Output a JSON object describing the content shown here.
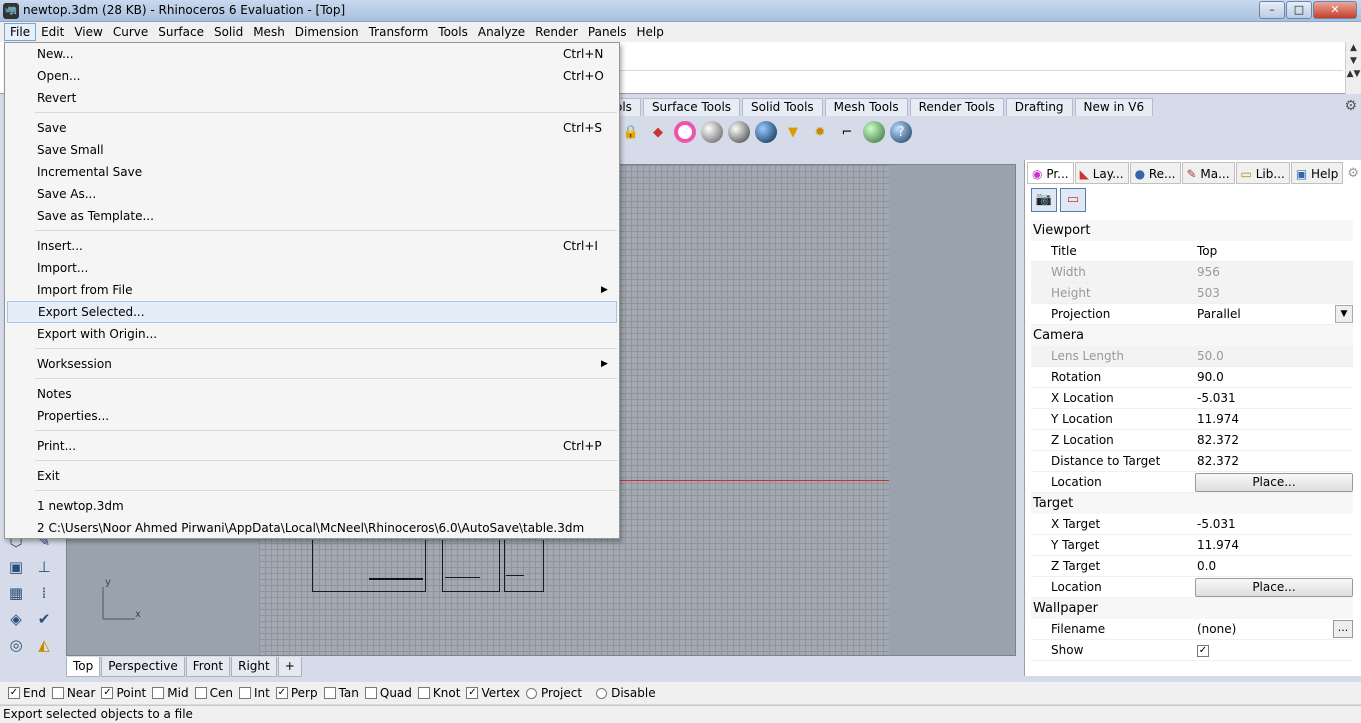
{
  "window": {
    "title": "newtop.3dm (28 KB) - Rhinoceros 6 Evaluation - [Top]",
    "minimize": "–",
    "maximize": "□",
    "close": "✕"
  },
  "menubar": [
    "File",
    "Edit",
    "View",
    "Curve",
    "Surface",
    "Solid",
    "Mesh",
    "Dimension",
    "Transform",
    "Tools",
    "Analyze",
    "Render",
    "Panels",
    "Help"
  ],
  "file_menu": {
    "groups": [
      [
        {
          "label": "New...",
          "shortcut": "Ctrl+N"
        },
        {
          "label": "Open...",
          "shortcut": "Ctrl+O"
        },
        {
          "label": "Revert",
          "shortcut": ""
        }
      ],
      [
        {
          "label": "Save",
          "shortcut": "Ctrl+S"
        },
        {
          "label": "Save Small",
          "shortcut": ""
        },
        {
          "label": "Incremental Save",
          "shortcut": ""
        },
        {
          "label": "Save As...",
          "shortcut": ""
        },
        {
          "label": "Save as Template...",
          "shortcut": ""
        }
      ],
      [
        {
          "label": "Insert...",
          "shortcut": "Ctrl+I"
        },
        {
          "label": "Import...",
          "shortcut": ""
        },
        {
          "label": "Import from File",
          "shortcut": "",
          "submenu": true
        },
        {
          "label": "Export Selected...",
          "shortcut": "",
          "hover": true
        },
        {
          "label": "Export with Origin...",
          "shortcut": ""
        }
      ],
      [
        {
          "label": "Worksession",
          "shortcut": "",
          "submenu": true
        }
      ],
      [
        {
          "label": "Notes",
          "shortcut": ""
        },
        {
          "label": "Properties...",
          "shortcut": ""
        }
      ],
      [
        {
          "label": "Print...",
          "shortcut": "Ctrl+P"
        }
      ],
      [
        {
          "label": "Exit",
          "shortcut": ""
        }
      ],
      [
        {
          "label": "1 newtop.3dm",
          "shortcut": ""
        },
        {
          "label": "2 C:\\Users\\Noor Ahmed Pirwani\\AppData\\Local\\McNeel\\Rhinoceros\\6.0\\AutoSave\\table.3dm",
          "shortcut": ""
        }
      ]
    ]
  },
  "toolbar_tabs": [
    "ols",
    "Surface Tools",
    "Solid Tools",
    "Mesh Tools",
    "Render Tools",
    "Drafting",
    "New in V6"
  ],
  "viewport": {
    "axis_y": "y",
    "axis_x": "x"
  },
  "view_tabs": [
    "Top",
    "Perspective",
    "Front",
    "Right"
  ],
  "add_view": "+",
  "panel": {
    "tabs": [
      "Pr...",
      "Lay...",
      "Re...",
      "Ma...",
      "Lib...",
      "Help"
    ],
    "sections": [
      {
        "title": "Viewport",
        "rows": [
          {
            "label": "Title",
            "value": "Top"
          },
          {
            "label": "Width",
            "value": "956",
            "disabled": true
          },
          {
            "label": "Height",
            "value": "503",
            "disabled": true
          },
          {
            "label": "Projection",
            "value": "Parallel",
            "dropdown": true
          }
        ]
      },
      {
        "title": "Camera",
        "rows": [
          {
            "label": "Lens Length",
            "value": "50.0",
            "disabled": true
          },
          {
            "label": "Rotation",
            "value": "90.0"
          },
          {
            "label": "X Location",
            "value": "-5.031"
          },
          {
            "label": "Y Location",
            "value": "11.974"
          },
          {
            "label": "Z Location",
            "value": "82.372"
          },
          {
            "label": "Distance to Target",
            "value": "82.372"
          },
          {
            "label": "Location",
            "value": "Place...",
            "button": true
          }
        ]
      },
      {
        "title": "Target",
        "rows": [
          {
            "label": "X Target",
            "value": "-5.031"
          },
          {
            "label": "Y Target",
            "value": "11.974"
          },
          {
            "label": "Z Target",
            "value": "0.0"
          },
          {
            "label": "Location",
            "value": "Place...",
            "button": true
          }
        ]
      },
      {
        "title": "Wallpaper",
        "rows": [
          {
            "label": "Filename",
            "value": "(none)",
            "ellipsis": true
          },
          {
            "label": "Show",
            "value": "",
            "checkbox": true
          }
        ]
      }
    ]
  },
  "osnaps": [
    {
      "label": "End",
      "checked": true
    },
    {
      "label": "Near",
      "checked": false
    },
    {
      "label": "Point",
      "checked": true
    },
    {
      "label": "Mid",
      "checked": false
    },
    {
      "label": "Cen",
      "checked": false
    },
    {
      "label": "Int",
      "checked": false
    },
    {
      "label": "Perp",
      "checked": true
    },
    {
      "label": "Tan",
      "checked": false
    },
    {
      "label": "Quad",
      "checked": false
    },
    {
      "label": "Knot",
      "checked": false
    },
    {
      "label": "Vertex",
      "checked": true
    },
    {
      "label": "Project",
      "radio": true
    },
    {
      "label": "Disable",
      "radio": true
    }
  ],
  "status": "Export selected objects to a file",
  "colors": {
    "accent": "#7da2ce",
    "grid_bg": "#a3a9b2",
    "redline": "#cc3333"
  }
}
